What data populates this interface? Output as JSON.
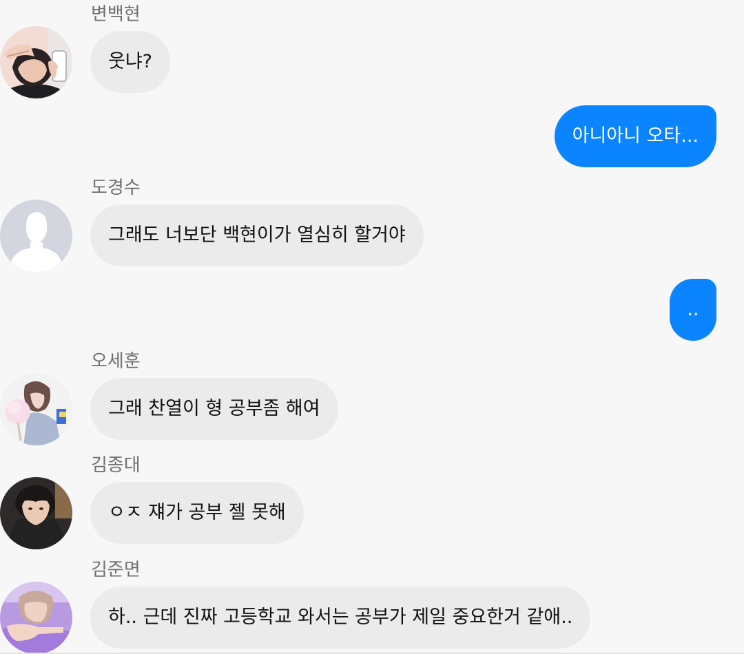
{
  "messages": [
    {
      "sender": "변백현",
      "text": "웃냐?",
      "avatar_icon": "person-photo-hand-over-face"
    },
    {
      "text": "아니아니 오타..."
    },
    {
      "sender": "도경수",
      "text": "그래도 너보단 백현이가 열심히 할거야",
      "avatar_icon": "default-user-silhouette"
    },
    {
      "text": ".."
    },
    {
      "sender": "오세훈",
      "text": "그래 찬열이 형 공부좀 해여",
      "avatar_icon": "person-photo-cotton-candy"
    },
    {
      "sender": "김종대",
      "text": "ㅇㅈ 쟤가 공부 젤 못해",
      "avatar_icon": "person-photo-dark-hood"
    },
    {
      "sender": "김준면",
      "text": "하.. 근데 진짜 고등학교 와서는 공부가 제일 중요한거 같애..",
      "avatar_icon": "person-photo-pointing-hand"
    }
  ],
  "colors": {
    "background": "#f7f7f8",
    "incoming_bubble": "#ebebeb",
    "outgoing_bubble": "#0a84ff",
    "sender_name": "#6f6f6f"
  }
}
